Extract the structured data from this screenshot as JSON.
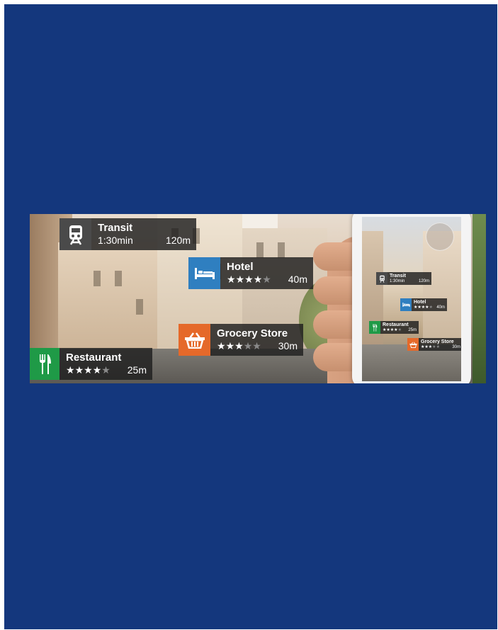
{
  "colors": {
    "frame_background": "#14377d",
    "transit_icon": "#4a4a4a",
    "hotel_icon": "#2f7fc0",
    "grocery_icon": "#e5692a",
    "restaurant_icon": "#1f9a47"
  },
  "cards": {
    "transit": {
      "icon": "train-icon",
      "title": "Transit",
      "time": "1:30min",
      "distance": "120m"
    },
    "hotel": {
      "icon": "bed-icon",
      "title": "Hotel",
      "rating": 4,
      "max_rating": 5,
      "distance": "40m"
    },
    "grocery": {
      "icon": "basket-icon",
      "title": "Grocery Store",
      "rating": 3,
      "max_rating": 5,
      "distance": "30m"
    },
    "restaurant": {
      "icon": "fork-knife-icon",
      "title": "Restaurant",
      "rating": 4,
      "max_rating": 5,
      "distance": "25m"
    }
  },
  "stars": {
    "filled": "★",
    "empty": "★"
  }
}
